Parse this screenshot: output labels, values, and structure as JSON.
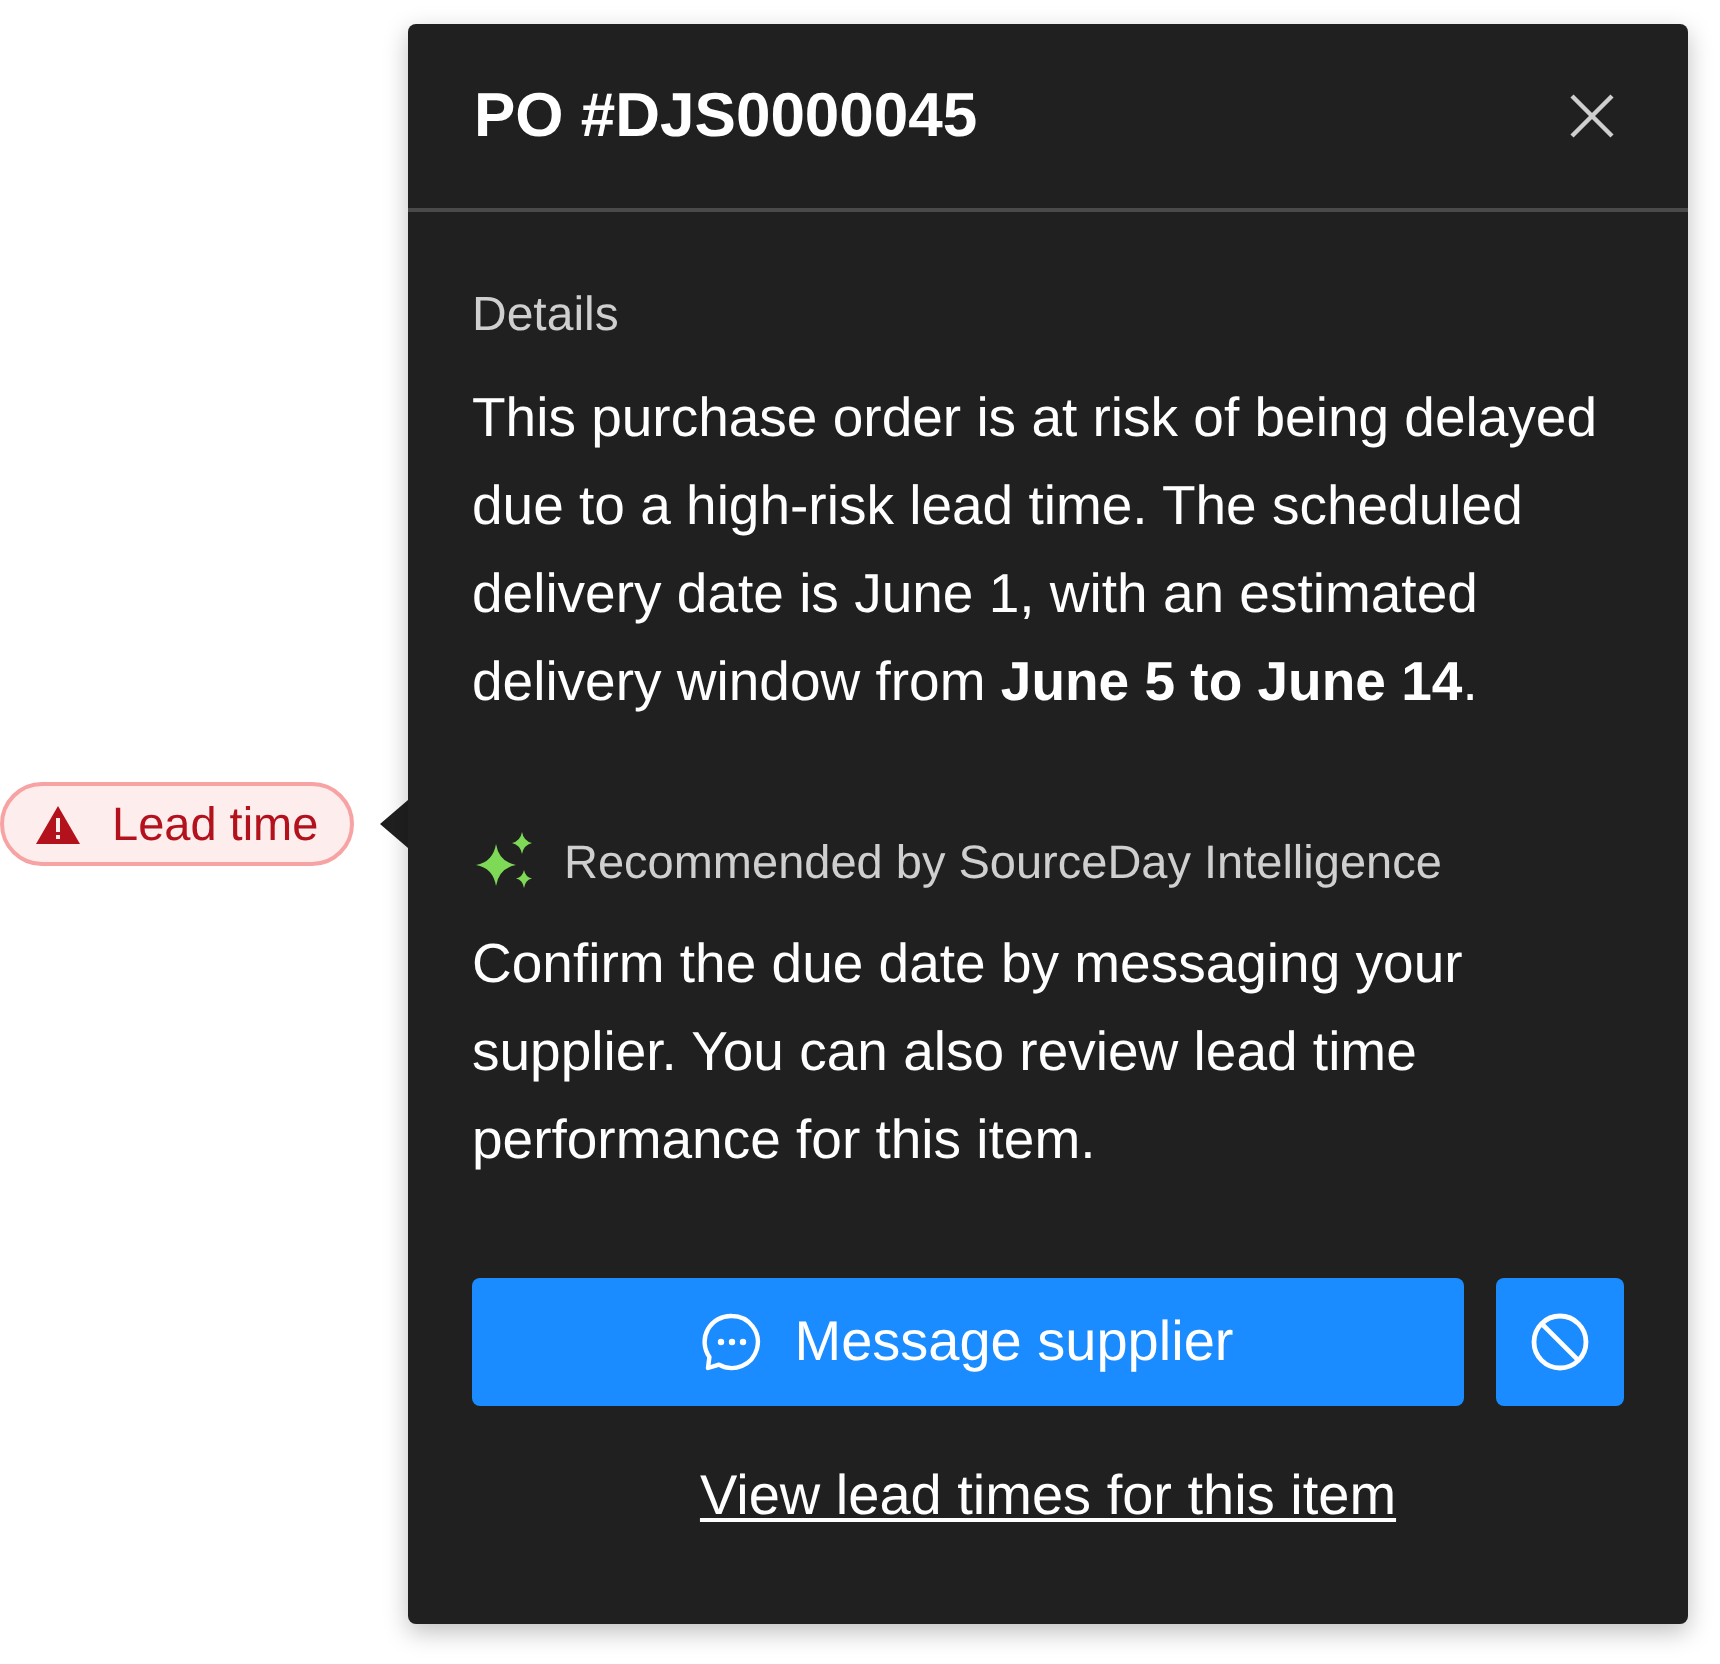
{
  "badge": {
    "label": "Lead time"
  },
  "popover": {
    "title": "PO #DJS0000045",
    "details_label": "Details",
    "details_text": "This purchase order is at risk of being delayed due to a high-risk lead time. The scheduled delivery date is June 1, with an estimated delivery window from **June 5 to June 14**.",
    "recommendation_label": "Recommended by SourceDay Intelligence",
    "recommendation_text": "Confirm the due date by messaging your supplier. You can also review lead time performance for this item.",
    "primary_button": "Message supplier",
    "link": "View lead times for this item"
  }
}
